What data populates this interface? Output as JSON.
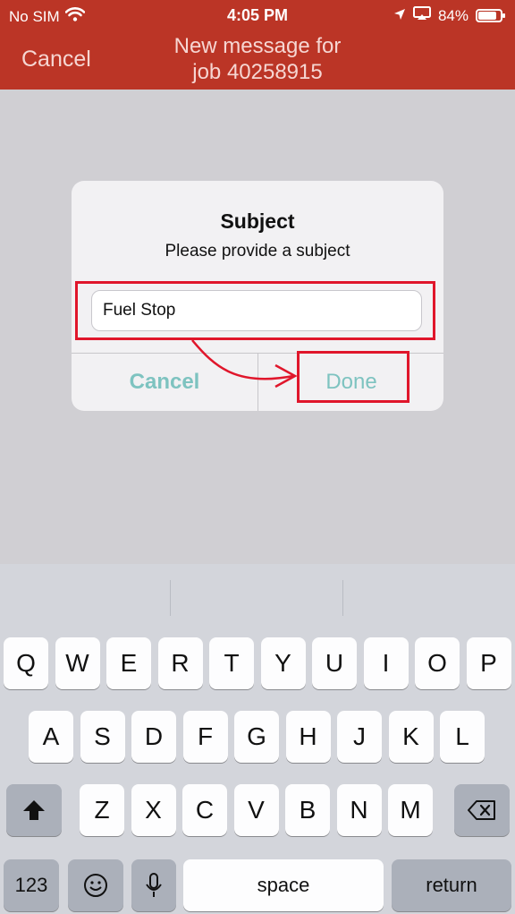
{
  "status_bar": {
    "carrier": "No SIM",
    "time": "4:05 PM",
    "battery_percent": "84%",
    "battery_level": 0.84
  },
  "nav": {
    "cancel_label": "Cancel",
    "title_line1": "New message for",
    "title_line2": "job 40258915"
  },
  "dialog": {
    "title": "Subject",
    "message": "Please provide a subject",
    "input_value": "Fuel Stop",
    "cancel_label": "Cancel",
    "done_label": "Done"
  },
  "keyboard": {
    "row1": [
      "Q",
      "W",
      "E",
      "R",
      "T",
      "Y",
      "U",
      "I",
      "O",
      "P"
    ],
    "row2": [
      "A",
      "S",
      "D",
      "F",
      "G",
      "H",
      "J",
      "K",
      "L"
    ],
    "row3": [
      "Z",
      "X",
      "C",
      "V",
      "B",
      "N",
      "M"
    ],
    "numbers_label": "123",
    "space_label": "space",
    "return_label": "return"
  },
  "colors": {
    "brand": "#bb3526",
    "dialog_button": "#7ec3c0",
    "annotation": "#e0162b"
  }
}
